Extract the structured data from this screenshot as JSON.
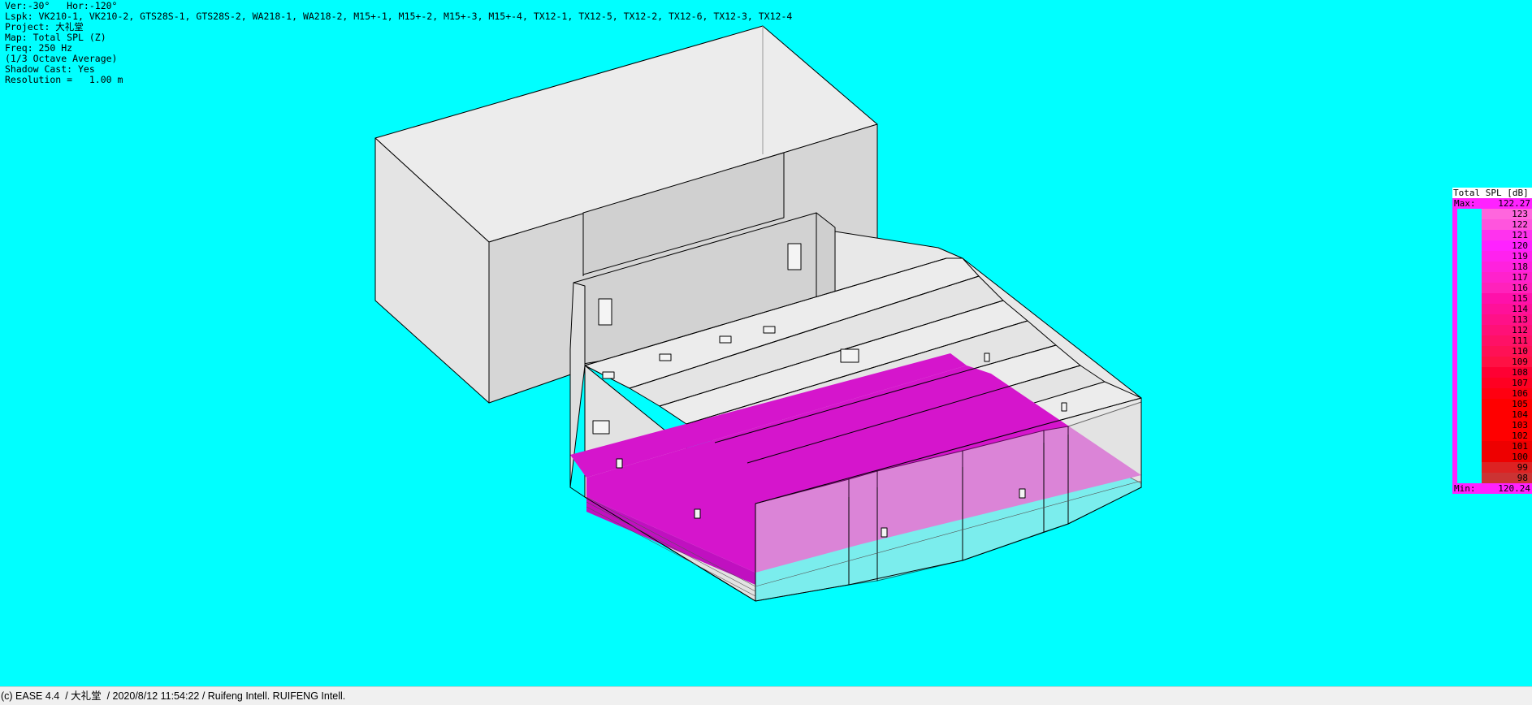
{
  "info": {
    "view": "Ver:-30°   Hor:-120°",
    "loudspeakers": "Lspk: VK210-1, VK210-2, GTS28S-1, GTS28S-2, WA218-1, WA218-2, M15+-1, M15+-2, M15+-3, M15+-4, TX12-1, TX12-5, TX12-2, TX12-6, TX12-3, TX12-4",
    "project": "Project: 大礼堂",
    "map": "Map: Total SPL (Z)",
    "freq": "Freq: 250 Hz",
    "average": "(1/3 Octave Average)",
    "shadow": "Shadow Cast: Yes",
    "resolution": "Resolution =   1.00 m"
  },
  "legend": {
    "title": "Total SPL [dB]",
    "max_label": "Max:",
    "max_value": "122.27",
    "min_label": "Min:",
    "min_value": "120.24",
    "levels": [
      "123",
      "122",
      "121",
      "120",
      "119",
      "118",
      "117",
      "116",
      "115",
      "114",
      "113",
      "112",
      "111",
      "110",
      "109",
      "108",
      "107",
      "106",
      "105",
      "104",
      "103",
      "102",
      "101",
      "100",
      "99",
      "98"
    ],
    "colors": [
      "#ff66dd",
      "#ff55dd",
      "#ff33ee",
      "#ff22ff",
      "#ff22ee",
      "#ff22dd",
      "#ff22cc",
      "#ff22bb",
      "#ff11aa",
      "#ff1199",
      "#ff1188",
      "#ff1177",
      "#ff1166",
      "#ff1155",
      "#ff1144",
      "#ff0033",
      "#ff0022",
      "#ff0011",
      "#ff0000",
      "#ff0000",
      "#ff0000",
      "#ff0000",
      "#ee0000",
      "#ee0000",
      "#dd2222",
      "#cc3333"
    ]
  },
  "colors": {
    "background": "#00ffff",
    "spl_map": "#d515cc",
    "wall_light": "#e6e6e6",
    "wall_mid": "#d4d4d4",
    "wall_dark": "#c4c4c4"
  },
  "status": {
    "text": "(c) EASE 4.4  / 大礼堂  / 2020/8/12 11:54:22 / Ruifeng Intell. RUIFENG Intell."
  }
}
